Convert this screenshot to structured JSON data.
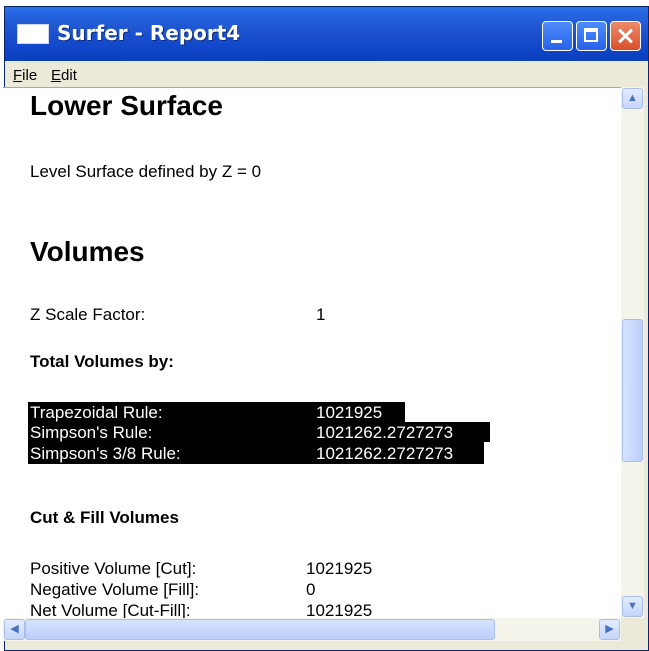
{
  "window": {
    "title": "Surfer - Report4"
  },
  "menu": [
    "File",
    "Edit"
  ],
  "report": {
    "lower_surface_heading": "Lower Surface",
    "level_surface_text": "Level Surface defined by Z = 0",
    "volumes_heading": "Volumes",
    "z_scale_label": "Z Scale Factor:",
    "z_scale_value": "1",
    "total_volumes_heading": "Total Volumes by:",
    "total_volumes": [
      {
        "label": "Trapezoidal Rule:",
        "value": "1021925"
      },
      {
        "label": "Simpson's Rule:",
        "value": "1021262.2727273"
      },
      {
        "label": "Simpson's 3/8 Rule:",
        "value": "1021262.2727273"
      }
    ],
    "cut_fill_heading": "Cut & Fill Volumes",
    "cut_fill": [
      {
        "label": "Positive Volume [Cut]:",
        "value": "1021925"
      },
      {
        "label": "Negative Volume [Fill]:",
        "value": "0"
      },
      {
        "label": "Net Volume [Cut-Fill]:",
        "value": "1021925"
      }
    ]
  },
  "colors": {
    "title_bar": "#0a3fbc",
    "selection": "#000000",
    "window_face": "#ece9d8"
  },
  "icons": [
    "app-icon",
    "minimize-icon",
    "maximize-icon",
    "close-icon",
    "scroll-up-arrow-icon",
    "scroll-down-arrow-icon",
    "scroll-left-arrow-icon",
    "scroll-right-arrow-icon",
    "resize-grip-icon"
  ]
}
